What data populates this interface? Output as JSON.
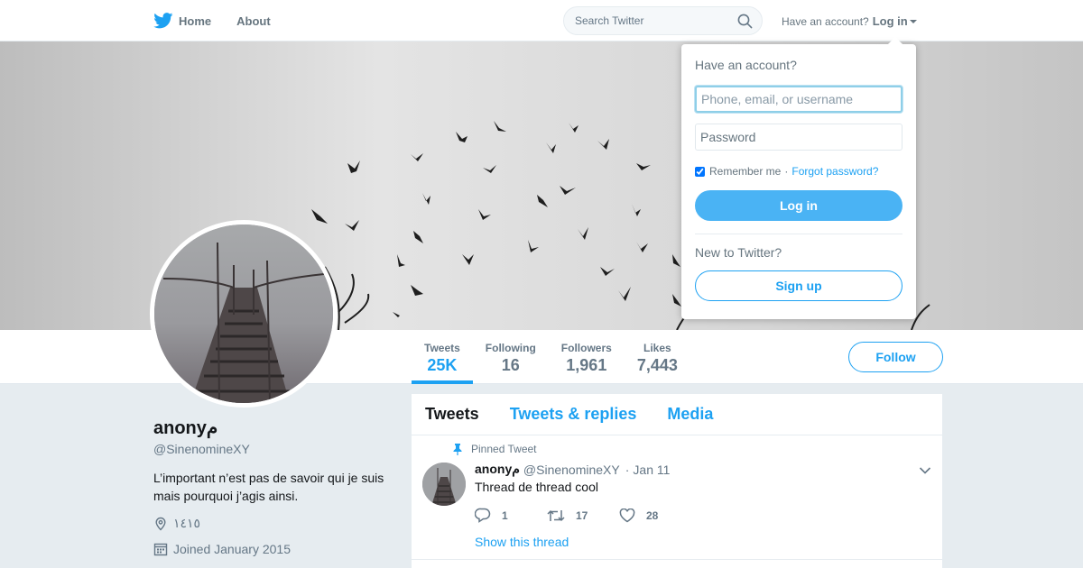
{
  "colors": {
    "accent": "#1da1f2",
    "login_button": "#4ab3f4",
    "page_bg": "#e6ecf0"
  },
  "nav": {
    "home_label": "Home",
    "about_label": "About",
    "search_placeholder": "Search Twitter",
    "account_prompt": "Have an account?",
    "login_label": "Log in",
    "icons": [
      "twitter-bird-icon",
      "search-icon",
      "caret-down-icon"
    ]
  },
  "profile_nav": {
    "stats": [
      {
        "label": "Tweets",
        "value": "25K",
        "active": true
      },
      {
        "label": "Following",
        "value": "16"
      },
      {
        "label": "Followers",
        "value": "1,961"
      },
      {
        "label": "Likes",
        "value": "7,443"
      }
    ],
    "follow_label": "Follow"
  },
  "profile": {
    "name": "anonyم",
    "handle": "@SinenomineXY",
    "bio": "L’important n’est pas de savoir qui je suis mais pourquoi j’agis ainsi.",
    "location": "١٤١٥",
    "joined": "Joined January 2015",
    "icons": [
      "location-pin-icon",
      "calendar-icon"
    ]
  },
  "timeline": {
    "tabs": [
      {
        "label": "Tweets",
        "active": true
      },
      {
        "label": "Tweets & replies"
      },
      {
        "label": "Media"
      }
    ],
    "tweet": {
      "pinned_label": "Pinned Tweet",
      "name": "anonyم",
      "handle": "@SinenomineXY",
      "date": "Jan 11",
      "text": "Thread de thread cool",
      "replies": "1",
      "retweets": "17",
      "likes": "28",
      "show_thread": "Show this thread",
      "icons": [
        "pin-icon",
        "reply-icon",
        "retweet-icon",
        "heart-icon",
        "chevron-down-icon"
      ]
    }
  },
  "login_dropdown": {
    "title": "Have an account?",
    "username_placeholder": "Phone, email, or username",
    "password_placeholder": "Password",
    "remember_label": "Remember me",
    "separator": "·",
    "forgot_label": "Forgot password?",
    "remember_checked": true,
    "login_button": "Log in",
    "new_prompt": "New to Twitter?",
    "signup_button": "Sign up"
  }
}
